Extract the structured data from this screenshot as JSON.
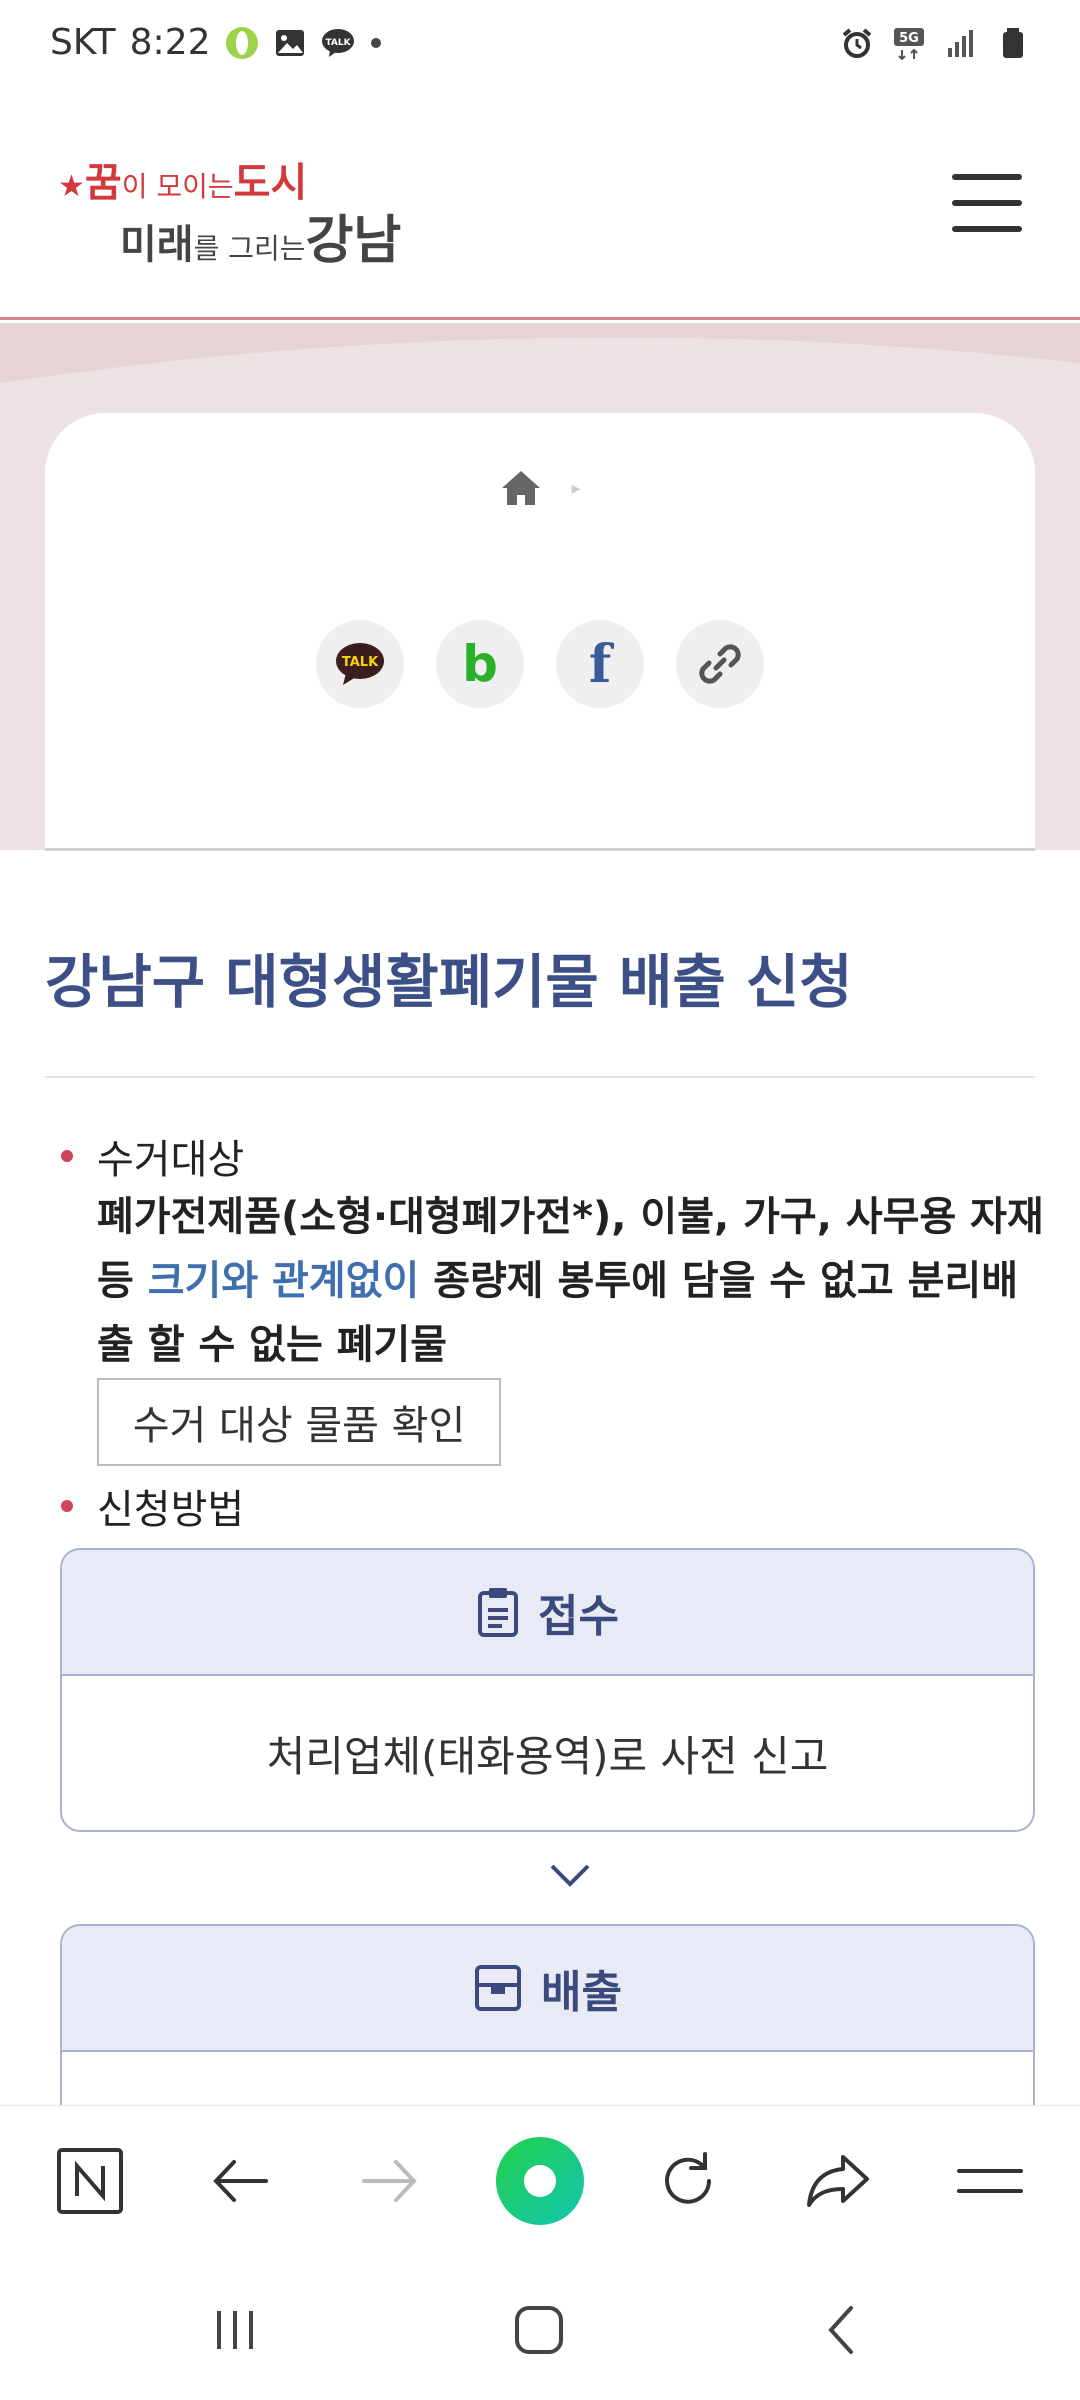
{
  "status_bar": {
    "carrier": "SKT",
    "time": "8:22",
    "network": "5G"
  },
  "header": {
    "logo": {
      "line1_big": "꿈",
      "line1_small": "이 모이는",
      "line1_end": "도시",
      "line2_a": "미래",
      "line2_small": "를 그리는",
      "line2_big": "강남"
    },
    "menu_icon": "hamburger-icon"
  },
  "breadcrumb": {
    "home_icon": "home-icon",
    "separator": "▸"
  },
  "share": {
    "kakaotalk_text": "TALK",
    "band_text": "b",
    "facebook_text": "f",
    "link_icon": "link-icon"
  },
  "page": {
    "title": "강남구 대형생활폐기물 배출 신청"
  },
  "section_collect": {
    "label": "수거대상",
    "desc_part1": "폐가전제품(소형·대형폐가전*), 이불, 가구, 사무용 자재 등 ",
    "desc_highlight": "크기와 관계없이",
    "desc_part2": " 종량제 봉투에 담을 수 없고 분리배출 할 수 없는 폐기물",
    "check_button": "수거 대상 물품 확인"
  },
  "section_method": {
    "label": "신청방법",
    "steps": [
      {
        "title": "접수",
        "body": "처리업체(태화용역)로 사전 신고",
        "icon": "clipboard-icon"
      },
      {
        "title": "배출",
        "body": "",
        "icon": "box-icon"
      }
    ]
  },
  "colors": {
    "accent_blue": "#3d4f87",
    "highlight_blue": "#3f6fb0",
    "bullet_red": "#d0435a",
    "hero_bg": "#ece1e3",
    "step_head_bg": "#e8ebf5",
    "browser_green": "#1fd16b"
  }
}
